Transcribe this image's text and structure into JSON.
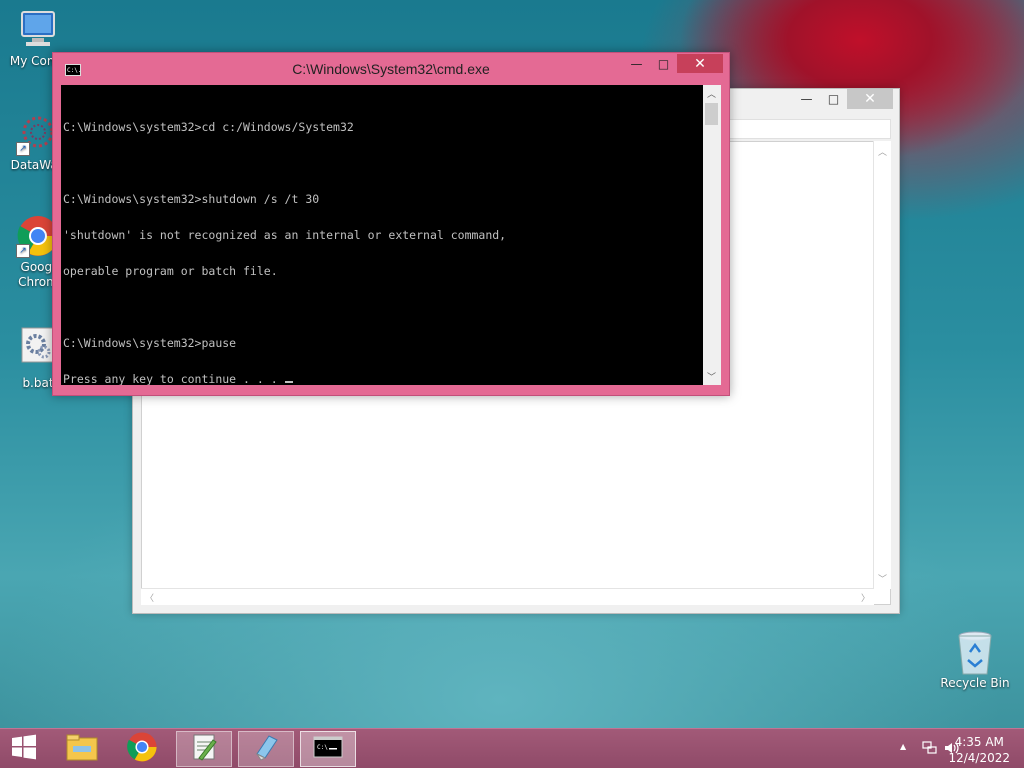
{
  "desktop": {
    "icons": [
      {
        "label": "My Comp"
      },
      {
        "label": "DataWag"
      },
      {
        "label": "Googl Chrom"
      },
      {
        "label": "b.bat"
      }
    ],
    "recycle_bin": {
      "label": "Recycle Bin"
    }
  },
  "cmd_window": {
    "title": "C:\\Windows\\System32\\cmd.exe",
    "icon_text": "C:\\.",
    "buttons": {
      "minimize": "—",
      "maximize": "□",
      "close": "✕"
    },
    "lines": [
      "C:\\Windows\\system32>cd c:/Windows/System32",
      "",
      "C:\\Windows\\system32>shutdown /s /t 30",
      "'shutdown' is not recognized as an internal or external command,",
      "operable program or batch file.",
      "",
      "C:\\Windows\\system32>pause",
      "Press any key to continue . . . "
    ]
  },
  "back_window": {
    "buttons": {
      "minimize": "—",
      "maximize": "□",
      "close": "✕"
    }
  },
  "taskbar": {
    "items": [
      {
        "name": "start-button",
        "icon": "windows-logo-icon"
      },
      {
        "name": "file-explorer",
        "icon": "folder-icon"
      },
      {
        "name": "chrome",
        "icon": "chrome-icon"
      },
      {
        "name": "notepad-plus-plus",
        "icon": "notepad-plus-plus-icon"
      },
      {
        "name": "notepad",
        "icon": "notepad-icon"
      },
      {
        "name": "cmd",
        "icon": "cmd-icon"
      }
    ],
    "tray": {
      "time": "4:35 AM",
      "date": "12/4/2022",
      "show_hidden_glyph": "▲"
    }
  },
  "colors": {
    "cmd_frame": "#e46a94",
    "taskbar": "#a25a78"
  }
}
